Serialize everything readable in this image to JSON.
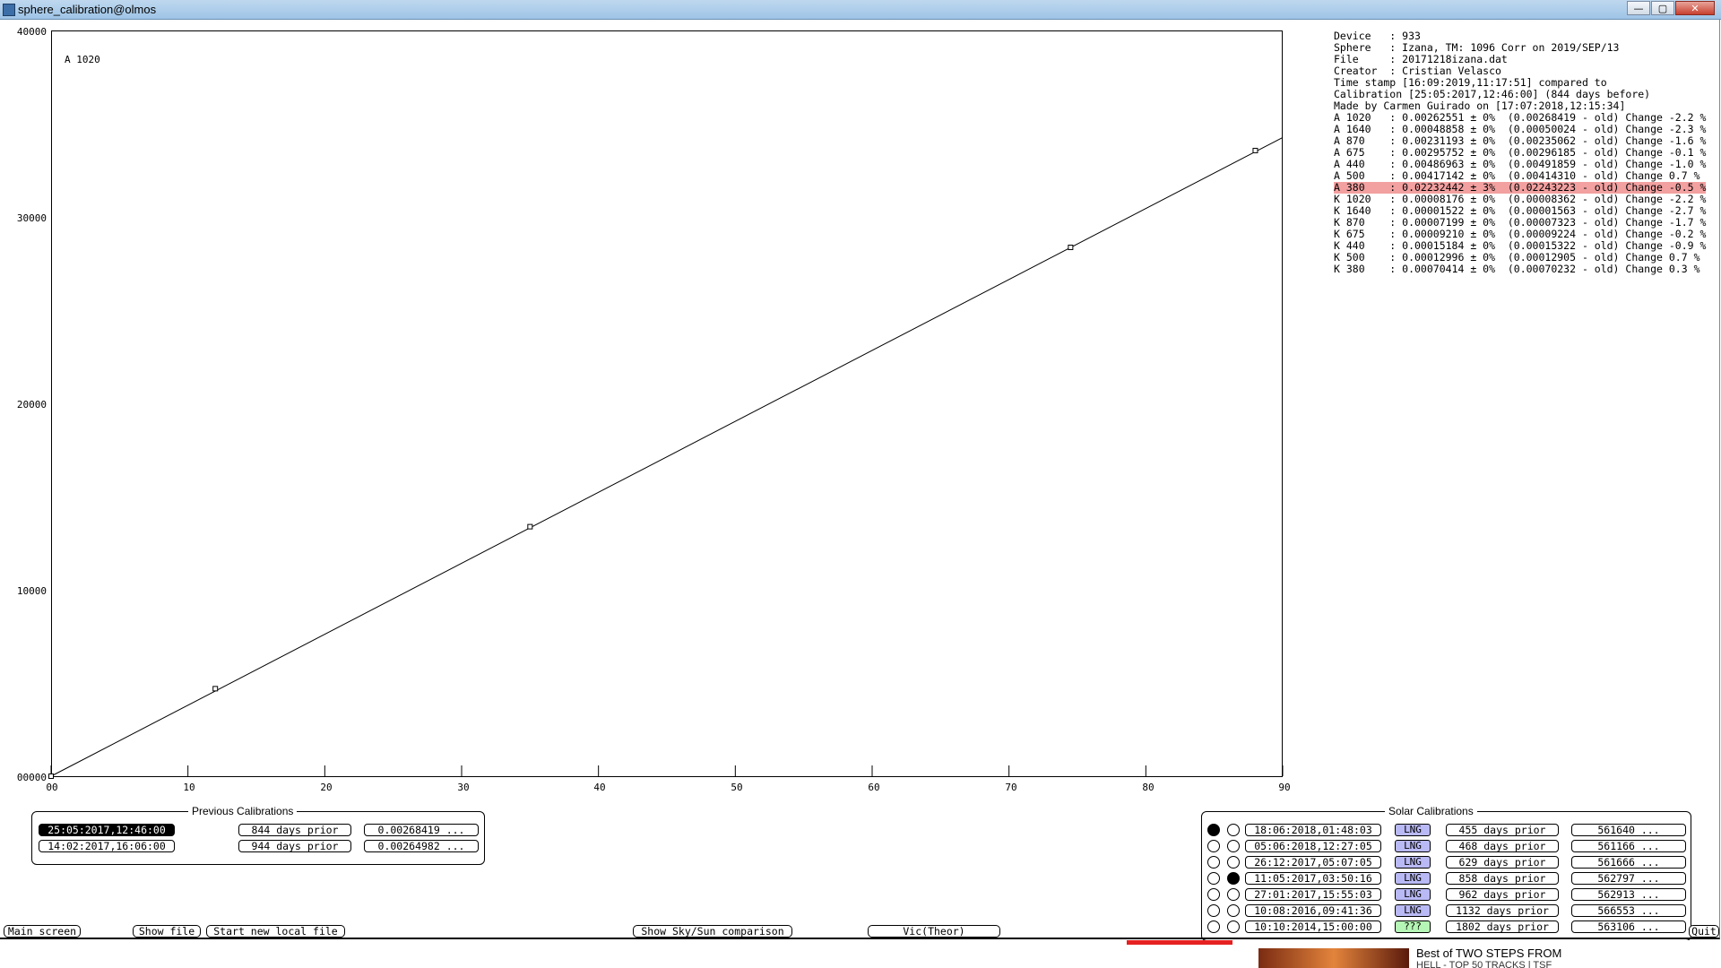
{
  "window": {
    "title": "sphere_calibration@olmos",
    "controls": {
      "minimize": "—",
      "maximize": "▢",
      "close": "✕"
    }
  },
  "plot": {
    "label": "A 1020",
    "y_ticks": [
      "40000",
      "30000",
      "20000",
      "10000",
      "00000"
    ],
    "x_ticks": [
      "00",
      "10",
      "20",
      "30",
      "40",
      "50",
      "60",
      "70",
      "80",
      "90"
    ]
  },
  "chart_data": {
    "type": "scatter",
    "title": "A 1020",
    "xlim": [
      0,
      90
    ],
    "ylim": [
      0,
      40000
    ],
    "points": [
      {
        "x": 0,
        "y": 0
      },
      {
        "x": 12,
        "y": 4700
      },
      {
        "x": 35,
        "y": 13400
      },
      {
        "x": 74.5,
        "y": 28400
      },
      {
        "x": 88,
        "y": 33600
      }
    ],
    "fit_line": {
      "x": [
        0,
        90
      ],
      "y": [
        0,
        34300
      ]
    }
  },
  "info": {
    "lines": [
      "Device   : 933",
      "Sphere   : Izana, TM: 1096 Corr on 2019/SEP/13",
      "File     : 20171218izana.dat",
      "Creator  : Cristian Velasco",
      "Time stamp [16:09:2019,11:17:51] compared to",
      "Calibration [25:05:2017,12:46:00] (844 days before)",
      "Made by Carmen Guirado on [17:07:2018,12:15:34]",
      "A 1020   : 0.00262551 ± 0%  (0.00268419 - old) Change -2.2 %",
      "A 1640   : 0.00048858 ± 0%  (0.00050024 - old) Change -2.3 %",
      "A 870    : 0.00231193 ± 0%  (0.00235062 - old) Change -1.6 %",
      "A 675    : 0.00295752 ± 0%  (0.00296185 - old) Change -0.1 %",
      "A 440    : 0.00486963 ± 0%  (0.00491859 - old) Change -1.0 %",
      "A 500    : 0.00417142 ± 0%  (0.00414310 - old) Change 0.7 %",
      "A 380    : 0.02232442 ± 3%  (0.02243223 - old) Change -0.5 %",
      "K 1020   : 0.00008176 ± 0%  (0.00008362 - old) Change -2.2 %",
      "K 1640   : 0.00001522 ± 0%  (0.00001563 - old) Change -2.7 %",
      "K 870    : 0.00007199 ± 0%  (0.00007323 - old) Change -1.7 %",
      "K 675    : 0.00009210 ± 0%  (0.00009224 - old) Change -0.2 %",
      "K 440    : 0.00015184 ± 0%  (0.00015322 - old) Change -0.9 %",
      "K 500    : 0.00012996 ± 0%  (0.00012905 - old) Change 0.7 %",
      "K 380    : 0.00070414 ± 0%  (0.00070232 - old) Change 0.3 %"
    ],
    "highlight_color": "#f2a0a0"
  },
  "previous": {
    "title": "Previous Calibrations",
    "rows": [
      {
        "date": "25:05:2017,12:46:00",
        "prior": "844 days prior",
        "value": "0.00268419 ...",
        "selected": true
      },
      {
        "date": "14:02:2017,16:06:00",
        "prior": "944 days prior",
        "value": "0.00264982 ...",
        "selected": false
      }
    ]
  },
  "solar": {
    "title": "Solar Calibrations",
    "rows": [
      {
        "r1": true,
        "r2": false,
        "date": "18:06:2018,01:48:03",
        "tag": "LNG",
        "prior": "455 days prior",
        "value": "561640 ..."
      },
      {
        "r1": false,
        "r2": false,
        "date": "05:06:2018,12:27:05",
        "tag": "LNG",
        "prior": "468 days prior",
        "value": "561166 ..."
      },
      {
        "r1": false,
        "r2": false,
        "date": "26:12:2017,05:07:05",
        "tag": "LNG",
        "prior": "629 days prior",
        "value": "561666 ..."
      },
      {
        "r1": false,
        "r2": true,
        "date": "11:05:2017,03:50:16",
        "tag": "LNG",
        "prior": "858 days prior",
        "value": "562797 ..."
      },
      {
        "r1": false,
        "r2": false,
        "date": "27:01:2017,15:55:03",
        "tag": "LNG",
        "prior": "962 days prior",
        "value": "562913 ..."
      },
      {
        "r1": false,
        "r2": false,
        "date": "10:08:2016,09:41:36",
        "tag": "LNG",
        "prior": "1132 days prior",
        "value": "566553 ..."
      },
      {
        "r1": false,
        "r2": false,
        "date": "10:10:2014,15:00:00",
        "tag": "???",
        "prior": "1802 days prior",
        "value": "563106 ..."
      }
    ],
    "tag_colors": {
      "LNG": "#b9b9f5",
      "???": "#b5f5b5"
    }
  },
  "buttons": {
    "main_screen": "Main screen",
    "show_file": "Show file",
    "start_new_local_file": "Start new local file",
    "show_sky_sun": "Show Sky/Sun comparison",
    "vic_theor": "Vic(Theor)",
    "quit": "Quit"
  },
  "background_strip": {
    "headline": "Best of TWO STEPS FROM",
    "subline": "HELL - TOP 50 TRACKS | TSF"
  }
}
